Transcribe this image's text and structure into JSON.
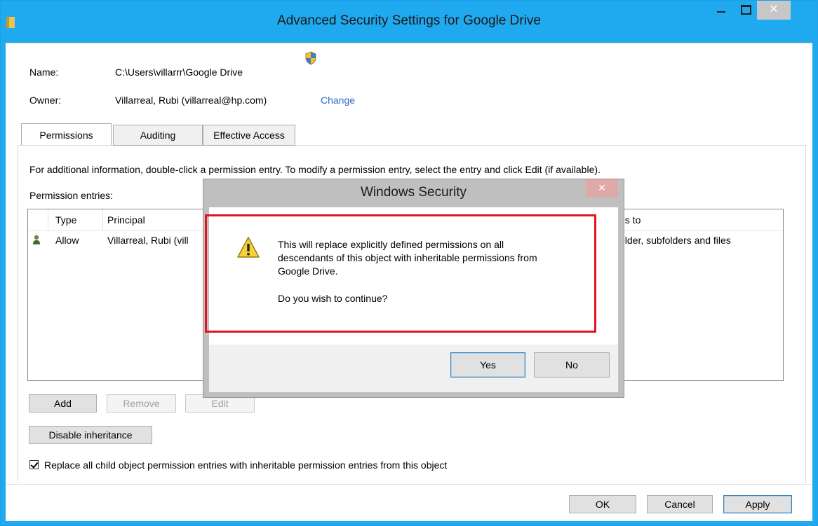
{
  "window": {
    "title": "Advanced Security Settings for Google Drive",
    "close_glyph": "✕"
  },
  "info": {
    "name_label": "Name:",
    "name_value": "C:\\Users\\villarrr\\Google Drive",
    "owner_label": "Owner:",
    "owner_value": "Villarreal, Rubi (villarreal@hp.com)",
    "change_link": "Change"
  },
  "tabs": [
    {
      "label": "Permissions",
      "active": true
    },
    {
      "label": "Auditing",
      "active": false
    },
    {
      "label": "Effective Access",
      "active": false
    }
  ],
  "instructions": "For additional information, double-click a permission entry. To modify a permission entry, select the entry and click Edit (if available).",
  "permission_entries_label": "Permission entries:",
  "table": {
    "columns": {
      "type": "Type",
      "principal": "Principal",
      "applies_to": "es to"
    },
    "rows": [
      {
        "type": "Allow",
        "principal": "Villarreal, Rubi (vill",
        "applies_to": "older, subfolders and files"
      }
    ]
  },
  "buttons": {
    "add": "Add",
    "remove": "Remove",
    "edit": "Edit",
    "disable_inheritance": "Disable inheritance",
    "ok": "OK",
    "cancel": "Cancel",
    "apply": "Apply"
  },
  "replace_checkbox": {
    "label": "Replace all child object permission entries with inheritable permission entries from this object",
    "checked": true
  },
  "dialog": {
    "title": "Windows Security",
    "close_glyph": "✕",
    "message_line1": "This will replace explicitly defined permissions on all",
    "message_line2": "descendants of this object with inheritable permissions from",
    "message_line3": "Google Drive.",
    "question": "Do you wish to continue?",
    "yes": "Yes",
    "no": "No",
    "icon": "warning-icon"
  },
  "colors": {
    "title_bar": "#1fa9ef",
    "highlight": "#e8121c",
    "link": "#2b6cc6"
  }
}
